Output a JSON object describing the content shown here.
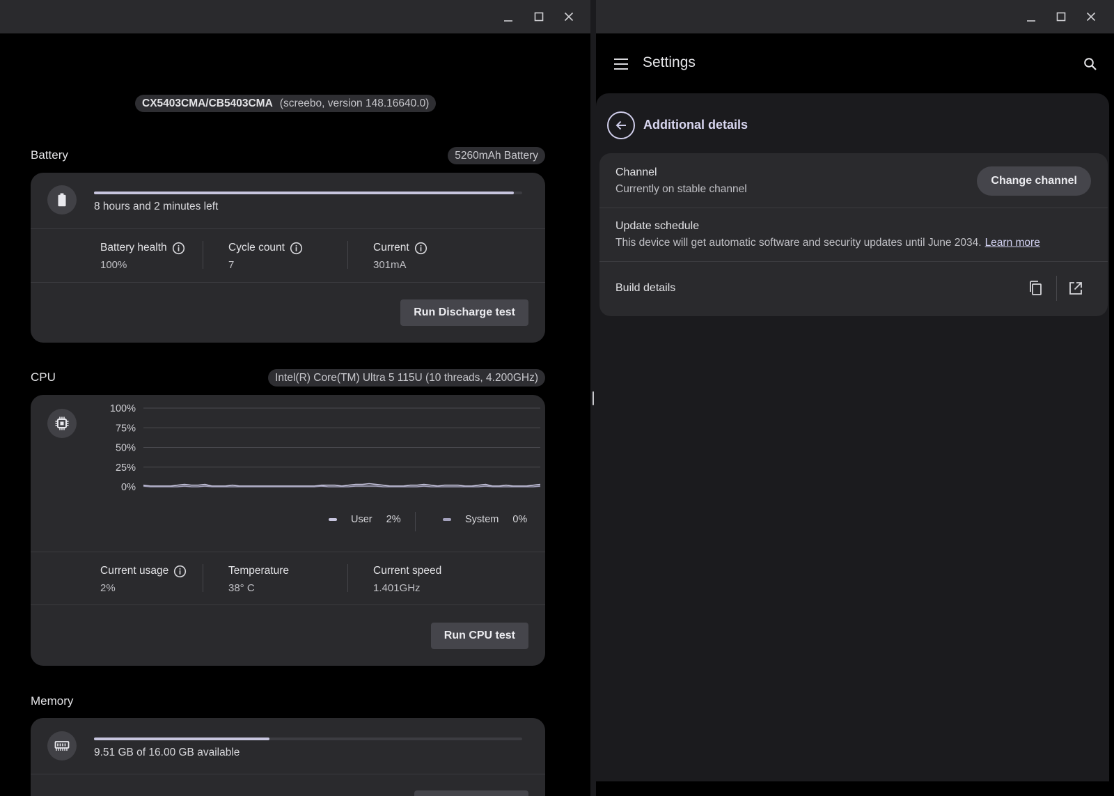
{
  "diagnostics": {
    "device": {
      "model": "CX5403CMA/CB5403CMA",
      "version": "(screebo, version 148.16640.0)"
    },
    "battery": {
      "title": "Battery",
      "chip": "5260mAh Battery",
      "charge_fraction": 0.98,
      "time_left": "8 hours and 2 minutes left",
      "stats": [
        {
          "label": "Battery health",
          "value": "100%"
        },
        {
          "label": "Cycle count",
          "value": "7"
        },
        {
          "label": "Current",
          "value": "301mA"
        }
      ],
      "test_button": "Run Discharge test"
    },
    "cpu": {
      "title": "CPU",
      "chip": "Intel(R) Core(TM) Ultra 5 115U (10 threads, 4.200GHz)",
      "stats": [
        {
          "label": "Current usage",
          "value": "2%"
        },
        {
          "label": "Temperature",
          "value": "38° C"
        },
        {
          "label": "Current speed",
          "value": "1.401GHz"
        }
      ],
      "legend": [
        {
          "label": "User",
          "value": "2%"
        },
        {
          "label": "System",
          "value": "0%"
        }
      ],
      "test_button": "Run CPU test"
    },
    "memory": {
      "title": "Memory",
      "used_fraction": 0.41,
      "available": "9.51 GB of 16.00 GB available"
    }
  },
  "chart_data": {
    "type": "line",
    "y_ticks": [
      "100%",
      "75%",
      "50%",
      "25%",
      "0%"
    ],
    "ylim": [
      0,
      100
    ],
    "grid": true,
    "series": [
      {
        "name": "User",
        "color": "#c7c5de",
        "values": [
          2,
          1,
          1,
          1,
          1,
          2,
          3,
          2,
          2,
          3,
          1,
          1,
          1,
          2,
          1,
          1,
          1,
          1,
          1,
          1,
          1,
          1,
          1,
          1,
          1,
          1,
          2,
          2,
          2,
          1,
          2,
          3,
          3,
          4,
          3,
          2,
          1,
          1,
          1,
          2,
          2,
          3,
          2,
          1,
          2,
          2,
          2,
          1,
          1,
          2,
          3,
          1,
          1,
          2,
          1,
          1,
          1,
          2,
          3
        ]
      },
      {
        "name": "System",
        "color": "#a3a1bc",
        "values": [
          1,
          0,
          0,
          0,
          0,
          0,
          1,
          0,
          0,
          1,
          0,
          0,
          0,
          0,
          0,
          0,
          0,
          0,
          0,
          0,
          0,
          0,
          0,
          0,
          0,
          0,
          1,
          0,
          0,
          0,
          0,
          1,
          1,
          1,
          1,
          0,
          0,
          0,
          0,
          0,
          0,
          1,
          0,
          0,
          0,
          0,
          0,
          0,
          0,
          0,
          1,
          0,
          0,
          0,
          0,
          0,
          0,
          0,
          1
        ]
      }
    ]
  },
  "settings": {
    "app_title": "Settings",
    "page_title": "Additional details",
    "channel": {
      "title": "Channel",
      "subtitle": "Currently on stable channel",
      "button": "Change channel"
    },
    "update": {
      "title": "Update schedule",
      "subtitle": "This device will get automatic software and security updates until June 2034.",
      "link": "Learn more"
    },
    "build": {
      "title": "Build details"
    }
  },
  "colors": {
    "accent": "#c7c5de",
    "card": "#2a2a2d",
    "surface": "#1b1b1e"
  }
}
